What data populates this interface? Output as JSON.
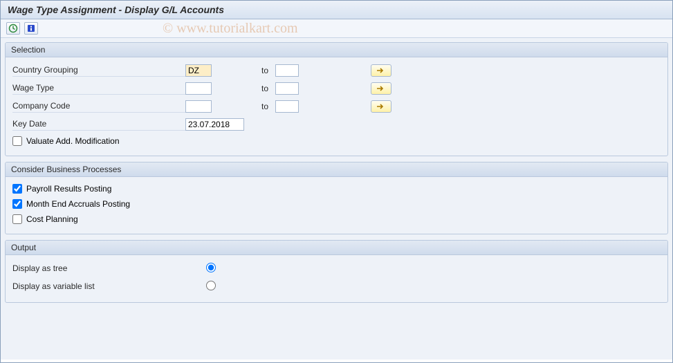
{
  "title": "Wage Type Assignment - Display G/L Accounts",
  "watermark": "© www.tutorialkart.com",
  "selection": {
    "title": "Selection",
    "rows": {
      "country": {
        "label": "Country Grouping",
        "from": "DZ",
        "to": "",
        "to_label": "to"
      },
      "wagetype": {
        "label": "Wage Type",
        "from": "",
        "to": "",
        "to_label": "to"
      },
      "company": {
        "label": "Company Code",
        "from": "",
        "to": "",
        "to_label": "to"
      },
      "keydate": {
        "label": "Key Date",
        "value": "23.07.2018"
      }
    },
    "valuate": {
      "label": "Valuate Add. Modification",
      "checked": false
    }
  },
  "processes": {
    "title": "Consider Business Processes",
    "payroll": {
      "label": "Payroll Results Posting",
      "checked": true
    },
    "monthend": {
      "label": "Month End Accruals Posting",
      "checked": true
    },
    "cost": {
      "label": "Cost Planning",
      "checked": false
    }
  },
  "output": {
    "title": "Output",
    "tree": {
      "label": "Display as tree",
      "selected": true
    },
    "list": {
      "label": "Display as variable list",
      "selected": false
    }
  }
}
